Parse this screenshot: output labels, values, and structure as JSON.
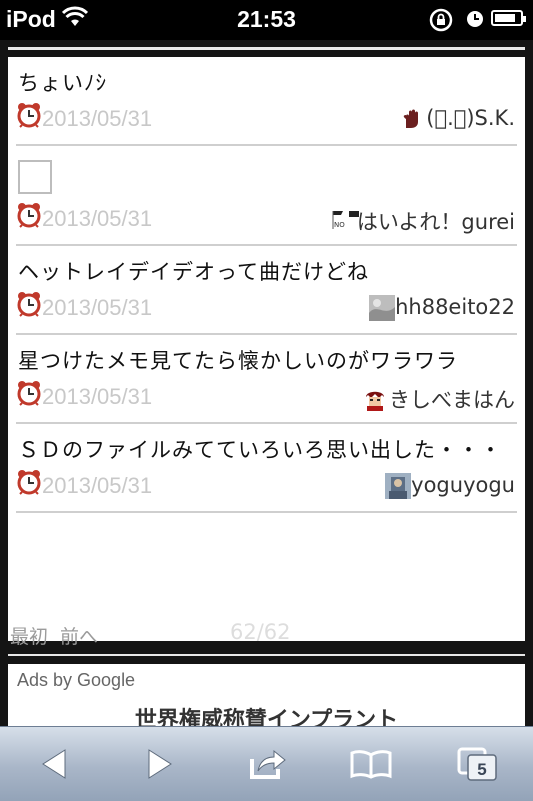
{
  "status_bar": {
    "carrier": "iPod",
    "time": "21:53",
    "battery_level": 0.85
  },
  "posts": [
    {
      "text": "ちょいﾉｼ",
      "date": "2013/05/31",
      "user": "(ﾟ.ﾟ)S.K.",
      "avatar": "hand-avatar",
      "has_checkbox_image": false
    },
    {
      "text": "",
      "date": "2013/05/31",
      "user": "はいよれ！gurei",
      "avatar": "flag-avatar",
      "has_checkbox_image": true
    },
    {
      "text": "ヘットレイデイデオって曲だけどね",
      "date": "2013/05/31",
      "user": "hh88eito22",
      "avatar": "gray-avatar",
      "has_checkbox_image": false
    },
    {
      "text": "星つけたメモ見てたら懐かしいのがワラワラ",
      "date": "2013/05/31",
      "user": "きしべまはん",
      "avatar": "anime-avatar",
      "has_checkbox_image": false
    },
    {
      "text": "ＳＤのファイルみてていろいろ思い出した・・・",
      "date": "2013/05/31",
      "user": "yoguyogu",
      "avatar": "photo-avatar",
      "has_checkbox_image": false
    }
  ],
  "pager": {
    "first": "最初",
    "prev": "前へ",
    "count": "62/62"
  },
  "ad": {
    "label": "Ads by Google",
    "title": "世界権威称賛インプラント"
  },
  "toolbar": {
    "tabs_count": "5"
  }
}
